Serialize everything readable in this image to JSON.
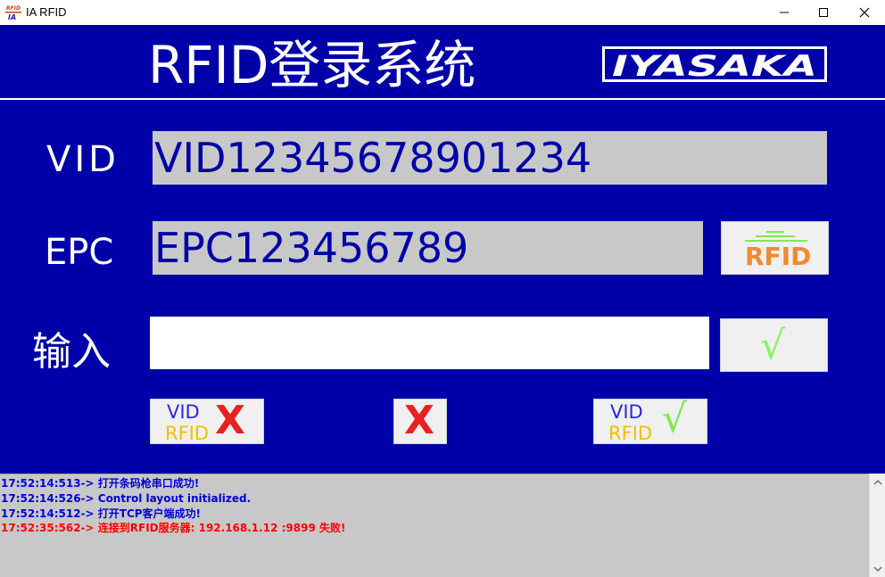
{
  "window": {
    "title": "IA RFID",
    "icon_text_top": "RFID",
    "icon_text_bottom": "IA"
  },
  "header": {
    "title": "RFID登录系统",
    "logo_text": "IYASAKA"
  },
  "labels": {
    "vid": "VID",
    "epc": "EPC",
    "input": "输入"
  },
  "fields": {
    "vid_value": "VID12345678901234",
    "epc_value": "EPC123456789",
    "input_value": ""
  },
  "buttons": {
    "rfid_label": "RFID",
    "confirm_glyph": "√",
    "vid_fail_top": "VID",
    "vid_fail_bottom": "RFID",
    "vid_fail_mark": "X",
    "clear_mark": "X",
    "vid_ok_top": "VID",
    "vid_ok_bottom": "RFID",
    "vid_ok_mark": "√"
  },
  "log": [
    {
      "text": "17:52:14:513-> 打开条码枪串口成功!",
      "color": "#0000d8"
    },
    {
      "text": "17:52:14:526-> Control layout initialized.",
      "color": "#0000d8"
    },
    {
      "text": "17:52:14:512-> 打开TCP客户端成功!",
      "color": "#0000d8"
    },
    {
      "text": "17:52:35:562-> 连接到RFID服务器: 192.168.1.12 :9899 失败!",
      "color": "#ff0000"
    }
  ],
  "colors": {
    "panel_bg": "#0000a8",
    "field_bg": "#c8c8c8",
    "accent_orange": "#f08a30",
    "accent_green": "#90f060",
    "accent_red": "#e82020"
  }
}
